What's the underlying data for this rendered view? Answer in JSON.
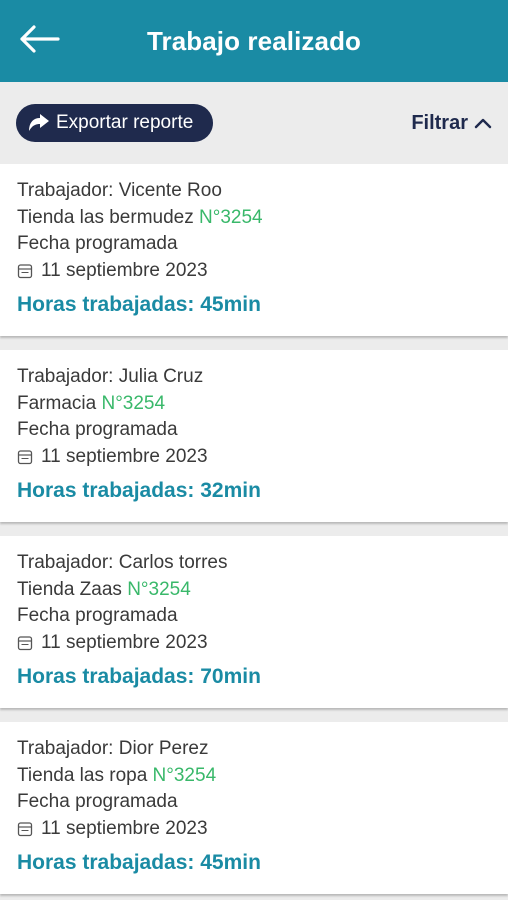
{
  "header": {
    "title": "Trabajo realizado",
    "back_icon": "arrow-left-icon"
  },
  "toolbar": {
    "export_label": "Exportar reporte",
    "filter_label": "Filtrar"
  },
  "colors": {
    "primary": "#1a8ba4",
    "navy": "#1f2a4d",
    "green": "#39b86a"
  },
  "records": [
    {
      "worker_label": "Trabajador: Vicente Roo",
      "store": "Tienda las bermudez",
      "number": "N°3254",
      "date_label": "Fecha programada",
      "date": "11 septiembre 2023",
      "hours": "Horas trabajadas: 45min"
    },
    {
      "worker_label": "Trabajador: Julia Cruz",
      "store": "Farmacia",
      "number": "N°3254",
      "date_label": "Fecha programada",
      "date": "11 septiembre 2023",
      "hours": "Horas trabajadas: 32min"
    },
    {
      "worker_label": "Trabajador: Carlos torres",
      "store": "Tienda Zaas",
      "number": "N°3254",
      "date_label": "Fecha programada",
      "date": "11 septiembre 2023",
      "hours": "Horas trabajadas: 70min"
    },
    {
      "worker_label": "Trabajador: Dior Perez",
      "store": "Tienda las ropa",
      "number": "N°3254",
      "date_label": "Fecha programada",
      "date": "11 septiembre 2023",
      "hours": "Horas trabajadas: 45min"
    }
  ]
}
